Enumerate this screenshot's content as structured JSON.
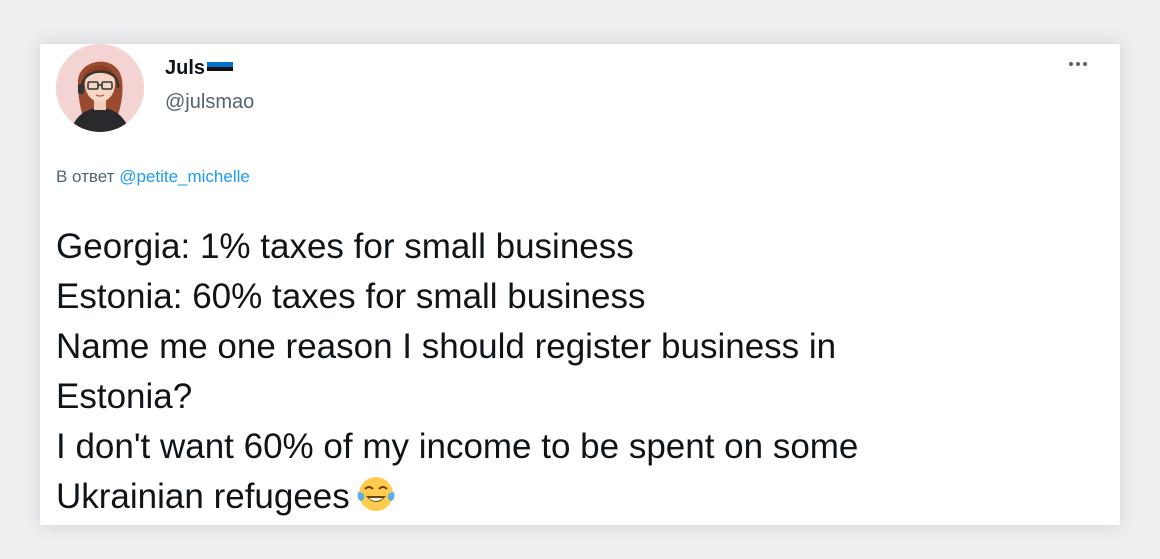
{
  "tweet": {
    "author": {
      "display_name": "Juls",
      "handle": "@julsmao",
      "flag": "estonia-flag-icon"
    },
    "more_label": "More options",
    "reply": {
      "prefix": "В ответ",
      "mention": "@petite_michelle"
    },
    "lines": [
      "Georgia: 1% taxes for small business",
      "Estonia: 60% taxes for small business",
      "Name me one reason I should register business in",
      "Estonia?",
      "I don't want 60% of my income to be spent on some",
      "Ukrainian refugees"
    ],
    "emoji": "face-with-tears-of-joy-icon"
  },
  "colors": {
    "mention": "#1d9bf0",
    "secondary_text": "#536471",
    "primary_text": "#0f1419",
    "flag_blue": "#0072ce",
    "flag_black": "#111111",
    "flag_white": "#ffffff"
  }
}
